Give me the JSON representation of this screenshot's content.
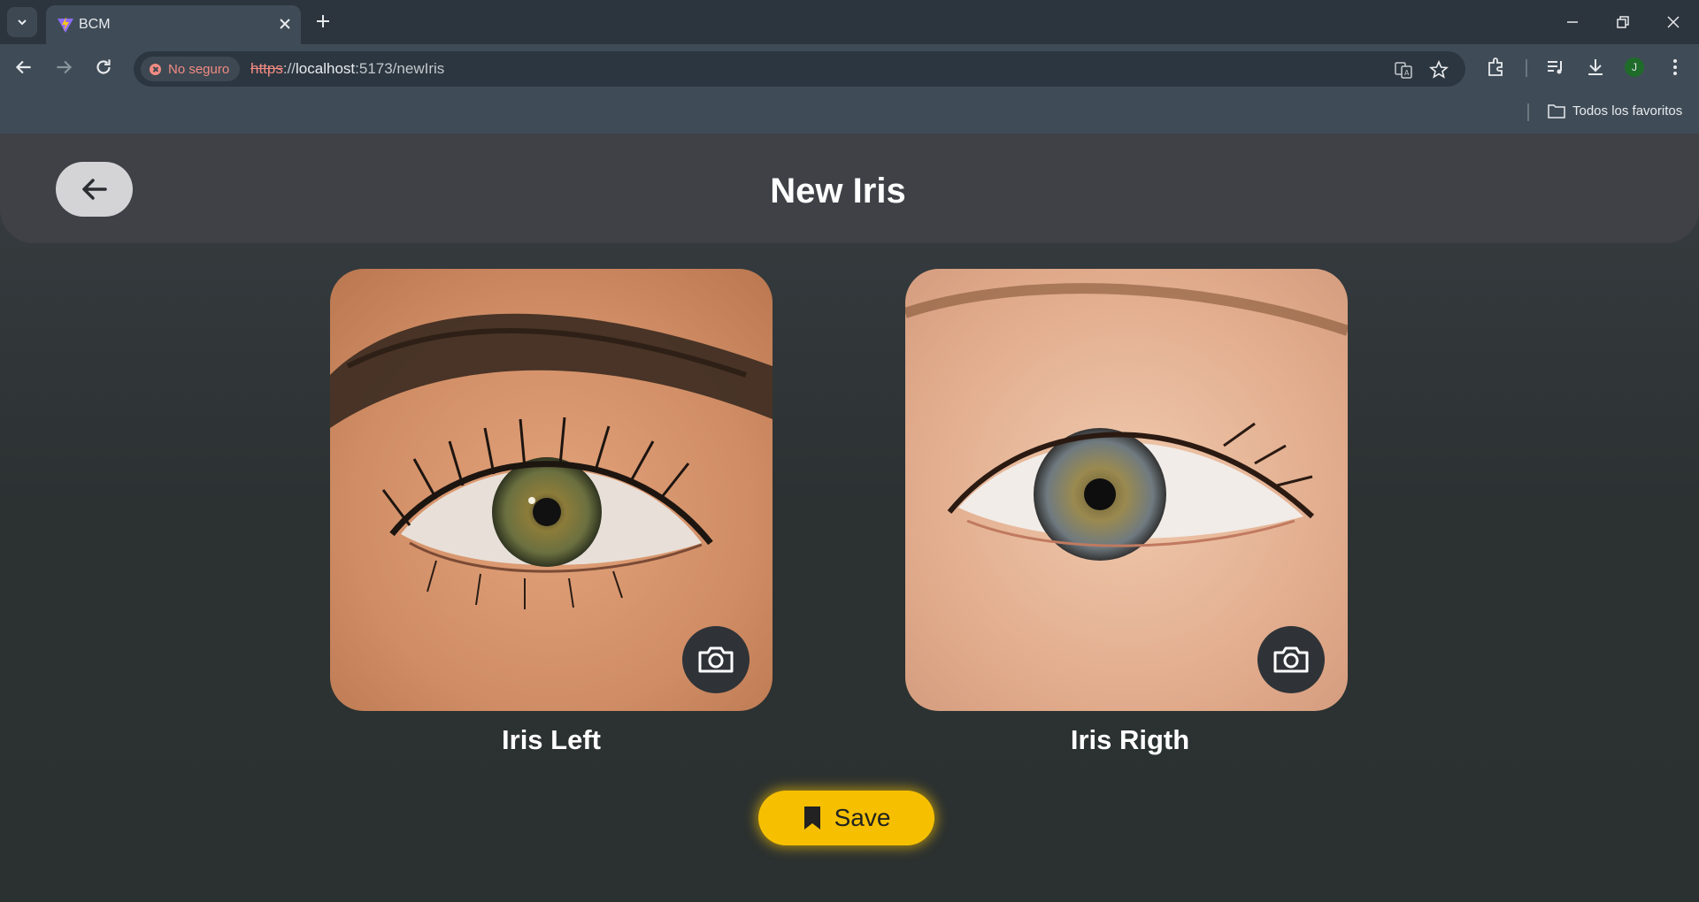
{
  "browser": {
    "tab": {
      "title": "BCM"
    },
    "address": {
      "security_label": "No seguro",
      "url_scheme": "https",
      "url_separator": "://",
      "url_host": "localhost",
      "url_rest": ":5173/newIris"
    },
    "avatar_letter": "J",
    "bookmarks": {
      "all_bookmarks_label": "Todos los favoritos"
    }
  },
  "app": {
    "title": "New Iris",
    "cards": [
      {
        "label": "Iris Left"
      },
      {
        "label": "Iris Rigth"
      }
    ],
    "save_label": "Save"
  },
  "colors": {
    "accent": "#f6c000",
    "header_bg": "#3f4147",
    "page_bg": "#2b3131"
  }
}
